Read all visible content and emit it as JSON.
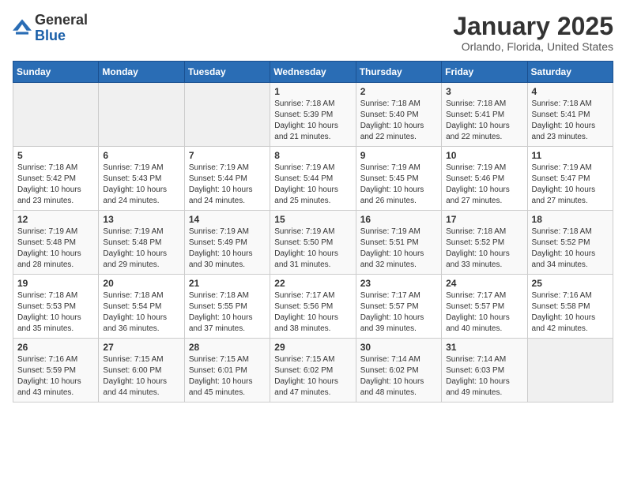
{
  "header": {
    "logo_general": "General",
    "logo_blue": "Blue",
    "month_title": "January 2025",
    "location": "Orlando, Florida, United States"
  },
  "days_of_week": [
    "Sunday",
    "Monday",
    "Tuesday",
    "Wednesday",
    "Thursday",
    "Friday",
    "Saturday"
  ],
  "weeks": [
    [
      {
        "day": "",
        "empty": true
      },
      {
        "day": "",
        "empty": true
      },
      {
        "day": "",
        "empty": true
      },
      {
        "day": "1",
        "sunrise": "Sunrise: 7:18 AM",
        "sunset": "Sunset: 5:39 PM",
        "daylight": "Daylight: 10 hours and 21 minutes."
      },
      {
        "day": "2",
        "sunrise": "Sunrise: 7:18 AM",
        "sunset": "Sunset: 5:40 PM",
        "daylight": "Daylight: 10 hours and 22 minutes."
      },
      {
        "day": "3",
        "sunrise": "Sunrise: 7:18 AM",
        "sunset": "Sunset: 5:41 PM",
        "daylight": "Daylight: 10 hours and 22 minutes."
      },
      {
        "day": "4",
        "sunrise": "Sunrise: 7:18 AM",
        "sunset": "Sunset: 5:41 PM",
        "daylight": "Daylight: 10 hours and 23 minutes."
      }
    ],
    [
      {
        "day": "5",
        "sunrise": "Sunrise: 7:18 AM",
        "sunset": "Sunset: 5:42 PM",
        "daylight": "Daylight: 10 hours and 23 minutes."
      },
      {
        "day": "6",
        "sunrise": "Sunrise: 7:19 AM",
        "sunset": "Sunset: 5:43 PM",
        "daylight": "Daylight: 10 hours and 24 minutes."
      },
      {
        "day": "7",
        "sunrise": "Sunrise: 7:19 AM",
        "sunset": "Sunset: 5:44 PM",
        "daylight": "Daylight: 10 hours and 24 minutes."
      },
      {
        "day": "8",
        "sunrise": "Sunrise: 7:19 AM",
        "sunset": "Sunset: 5:44 PM",
        "daylight": "Daylight: 10 hours and 25 minutes."
      },
      {
        "day": "9",
        "sunrise": "Sunrise: 7:19 AM",
        "sunset": "Sunset: 5:45 PM",
        "daylight": "Daylight: 10 hours and 26 minutes."
      },
      {
        "day": "10",
        "sunrise": "Sunrise: 7:19 AM",
        "sunset": "Sunset: 5:46 PM",
        "daylight": "Daylight: 10 hours and 27 minutes."
      },
      {
        "day": "11",
        "sunrise": "Sunrise: 7:19 AM",
        "sunset": "Sunset: 5:47 PM",
        "daylight": "Daylight: 10 hours and 27 minutes."
      }
    ],
    [
      {
        "day": "12",
        "sunrise": "Sunrise: 7:19 AM",
        "sunset": "Sunset: 5:48 PM",
        "daylight": "Daylight: 10 hours and 28 minutes."
      },
      {
        "day": "13",
        "sunrise": "Sunrise: 7:19 AM",
        "sunset": "Sunset: 5:48 PM",
        "daylight": "Daylight: 10 hours and 29 minutes."
      },
      {
        "day": "14",
        "sunrise": "Sunrise: 7:19 AM",
        "sunset": "Sunset: 5:49 PM",
        "daylight": "Daylight: 10 hours and 30 minutes."
      },
      {
        "day": "15",
        "sunrise": "Sunrise: 7:19 AM",
        "sunset": "Sunset: 5:50 PM",
        "daylight": "Daylight: 10 hours and 31 minutes."
      },
      {
        "day": "16",
        "sunrise": "Sunrise: 7:19 AM",
        "sunset": "Sunset: 5:51 PM",
        "daylight": "Daylight: 10 hours and 32 minutes."
      },
      {
        "day": "17",
        "sunrise": "Sunrise: 7:18 AM",
        "sunset": "Sunset: 5:52 PM",
        "daylight": "Daylight: 10 hours and 33 minutes."
      },
      {
        "day": "18",
        "sunrise": "Sunrise: 7:18 AM",
        "sunset": "Sunset: 5:52 PM",
        "daylight": "Daylight: 10 hours and 34 minutes."
      }
    ],
    [
      {
        "day": "19",
        "sunrise": "Sunrise: 7:18 AM",
        "sunset": "Sunset: 5:53 PM",
        "daylight": "Daylight: 10 hours and 35 minutes."
      },
      {
        "day": "20",
        "sunrise": "Sunrise: 7:18 AM",
        "sunset": "Sunset: 5:54 PM",
        "daylight": "Daylight: 10 hours and 36 minutes."
      },
      {
        "day": "21",
        "sunrise": "Sunrise: 7:18 AM",
        "sunset": "Sunset: 5:55 PM",
        "daylight": "Daylight: 10 hours and 37 minutes."
      },
      {
        "day": "22",
        "sunrise": "Sunrise: 7:17 AM",
        "sunset": "Sunset: 5:56 PM",
        "daylight": "Daylight: 10 hours and 38 minutes."
      },
      {
        "day": "23",
        "sunrise": "Sunrise: 7:17 AM",
        "sunset": "Sunset: 5:57 PM",
        "daylight": "Daylight: 10 hours and 39 minutes."
      },
      {
        "day": "24",
        "sunrise": "Sunrise: 7:17 AM",
        "sunset": "Sunset: 5:57 PM",
        "daylight": "Daylight: 10 hours and 40 minutes."
      },
      {
        "day": "25",
        "sunrise": "Sunrise: 7:16 AM",
        "sunset": "Sunset: 5:58 PM",
        "daylight": "Daylight: 10 hours and 42 minutes."
      }
    ],
    [
      {
        "day": "26",
        "sunrise": "Sunrise: 7:16 AM",
        "sunset": "Sunset: 5:59 PM",
        "daylight": "Daylight: 10 hours and 43 minutes."
      },
      {
        "day": "27",
        "sunrise": "Sunrise: 7:15 AM",
        "sunset": "Sunset: 6:00 PM",
        "daylight": "Daylight: 10 hours and 44 minutes."
      },
      {
        "day": "28",
        "sunrise": "Sunrise: 7:15 AM",
        "sunset": "Sunset: 6:01 PM",
        "daylight": "Daylight: 10 hours and 45 minutes."
      },
      {
        "day": "29",
        "sunrise": "Sunrise: 7:15 AM",
        "sunset": "Sunset: 6:02 PM",
        "daylight": "Daylight: 10 hours and 47 minutes."
      },
      {
        "day": "30",
        "sunrise": "Sunrise: 7:14 AM",
        "sunset": "Sunset: 6:02 PM",
        "daylight": "Daylight: 10 hours and 48 minutes."
      },
      {
        "day": "31",
        "sunrise": "Sunrise: 7:14 AM",
        "sunset": "Sunset: 6:03 PM",
        "daylight": "Daylight: 10 hours and 49 minutes."
      },
      {
        "day": "",
        "empty": true
      }
    ]
  ]
}
